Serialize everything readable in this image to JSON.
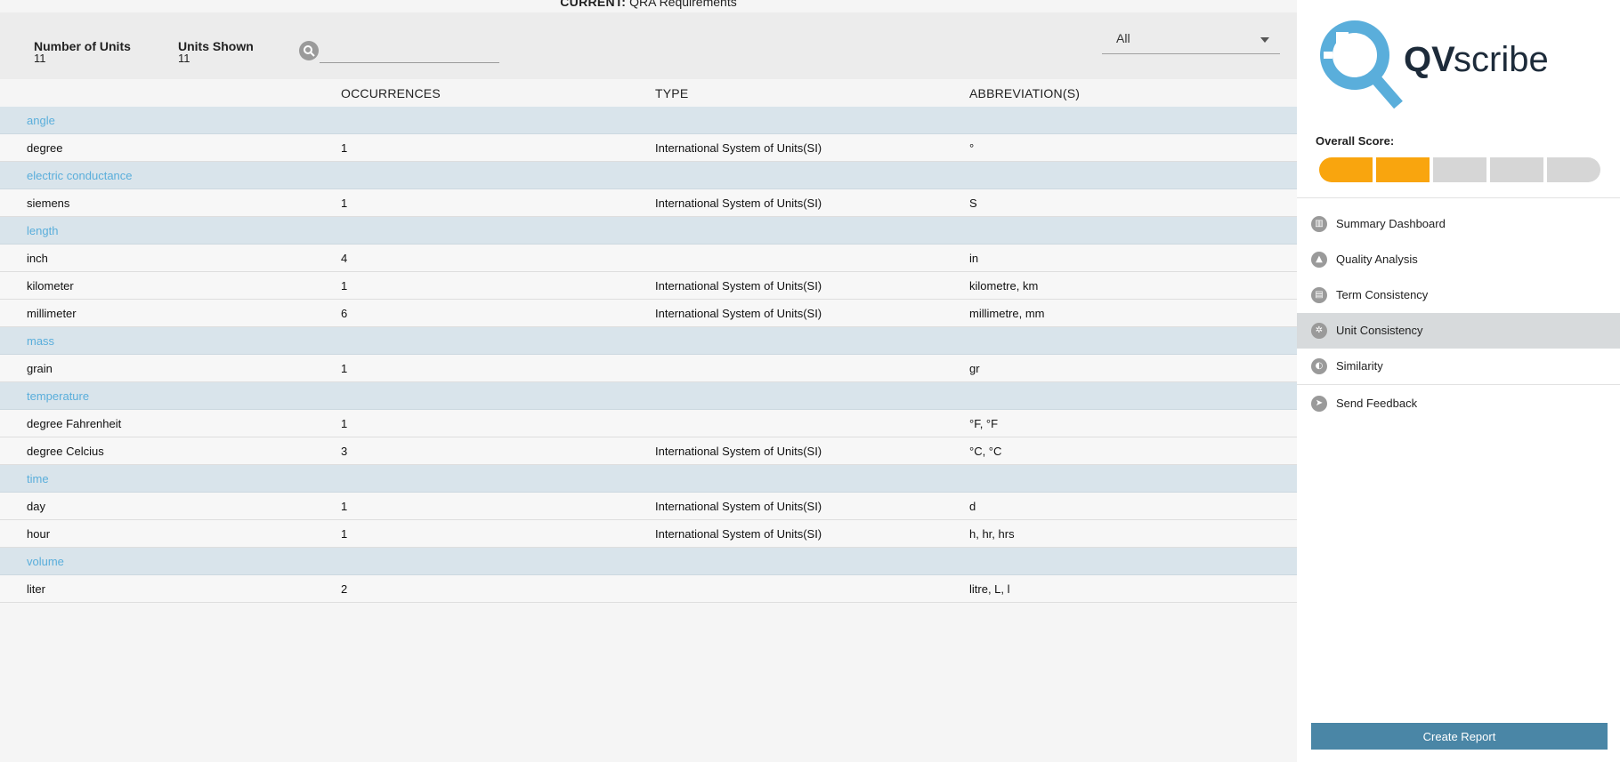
{
  "document": {
    "prefix": "CURRENT:",
    "name": "QRA Requirements"
  },
  "stats": {
    "number_of_units_label": "Number of Units",
    "number_of_units_value": "11",
    "units_shown_label": "Units Shown",
    "units_shown_value": "11"
  },
  "search": {
    "placeholder": "",
    "value": "",
    "icon": "search-icon"
  },
  "filter": {
    "selected": "All"
  },
  "table": {
    "headers": [
      "",
      "OCCURRENCES",
      "TYPE",
      "ABBREVIATION(S)"
    ],
    "rows": [
      {
        "kind": "category",
        "cells": [
          "angle",
          "",
          "",
          ""
        ]
      },
      {
        "kind": "unit",
        "cells": [
          "degree",
          "1",
          "International System of Units(SI)",
          "°"
        ]
      },
      {
        "kind": "category",
        "cells": [
          "electric conductance",
          "",
          "",
          ""
        ]
      },
      {
        "kind": "unit",
        "cells": [
          "siemens",
          "1",
          "International System of Units(SI)",
          "S"
        ]
      },
      {
        "kind": "category",
        "cells": [
          "length",
          "",
          "",
          ""
        ]
      },
      {
        "kind": "unit",
        "cells": [
          "inch",
          "4",
          "",
          "in"
        ]
      },
      {
        "kind": "unit",
        "cells": [
          "kilometer",
          "1",
          "International System of Units(SI)",
          "kilometre, km"
        ]
      },
      {
        "kind": "unit",
        "cells": [
          "millimeter",
          "6",
          "International System of Units(SI)",
          "millimetre, mm"
        ]
      },
      {
        "kind": "category",
        "cells": [
          "mass",
          "",
          "",
          ""
        ]
      },
      {
        "kind": "unit",
        "cells": [
          "grain",
          "1",
          "",
          "gr"
        ]
      },
      {
        "kind": "category",
        "cells": [
          "temperature",
          "",
          "",
          ""
        ]
      },
      {
        "kind": "unit",
        "cells": [
          "degree Fahrenheit",
          "1",
          "",
          "°F, °F"
        ]
      },
      {
        "kind": "unit",
        "cells": [
          "degree Celcius",
          "3",
          "International System of Units(SI)",
          "°C, °C"
        ]
      },
      {
        "kind": "category",
        "cells": [
          "time",
          "",
          "",
          ""
        ]
      },
      {
        "kind": "unit",
        "cells": [
          "day",
          "1",
          "International System of Units(SI)",
          "d"
        ]
      },
      {
        "kind": "unit",
        "cells": [
          "hour",
          "1",
          "International System of Units(SI)",
          "h, hr, hrs"
        ]
      },
      {
        "kind": "category",
        "cells": [
          "volume",
          "",
          "",
          ""
        ]
      },
      {
        "kind": "unit",
        "cells": [
          "liter",
          "2",
          "",
          "litre, L, l"
        ]
      }
    ]
  },
  "sidebar": {
    "logo_text_bold": "QV",
    "logo_text": "scribe",
    "overall_score_label": "Overall Score:",
    "score": {
      "value": 2,
      "max": 5,
      "on_color": "#f9a50e",
      "off_color": "#d6d6d6"
    },
    "nav": [
      {
        "label": "Summary Dashboard",
        "icon": "dashboard-icon",
        "active": false
      },
      {
        "label": "Quality Analysis",
        "icon": "warning-icon",
        "active": false
      },
      {
        "label": "Term Consistency",
        "icon": "book-icon",
        "active": false
      },
      {
        "label": "Unit Consistency",
        "icon": "gear-icon",
        "active": true
      },
      {
        "label": "Similarity",
        "icon": "similarity-icon",
        "active": false
      },
      {
        "label": "Send Feedback",
        "icon": "send-icon",
        "active": false
      }
    ],
    "create_report_label": "Create Report"
  },
  "colors": {
    "accent_blue": "#5aaedb",
    "button_blue": "#4a86a6",
    "score_orange": "#f9a50e",
    "navy": "#1d2b3a"
  }
}
